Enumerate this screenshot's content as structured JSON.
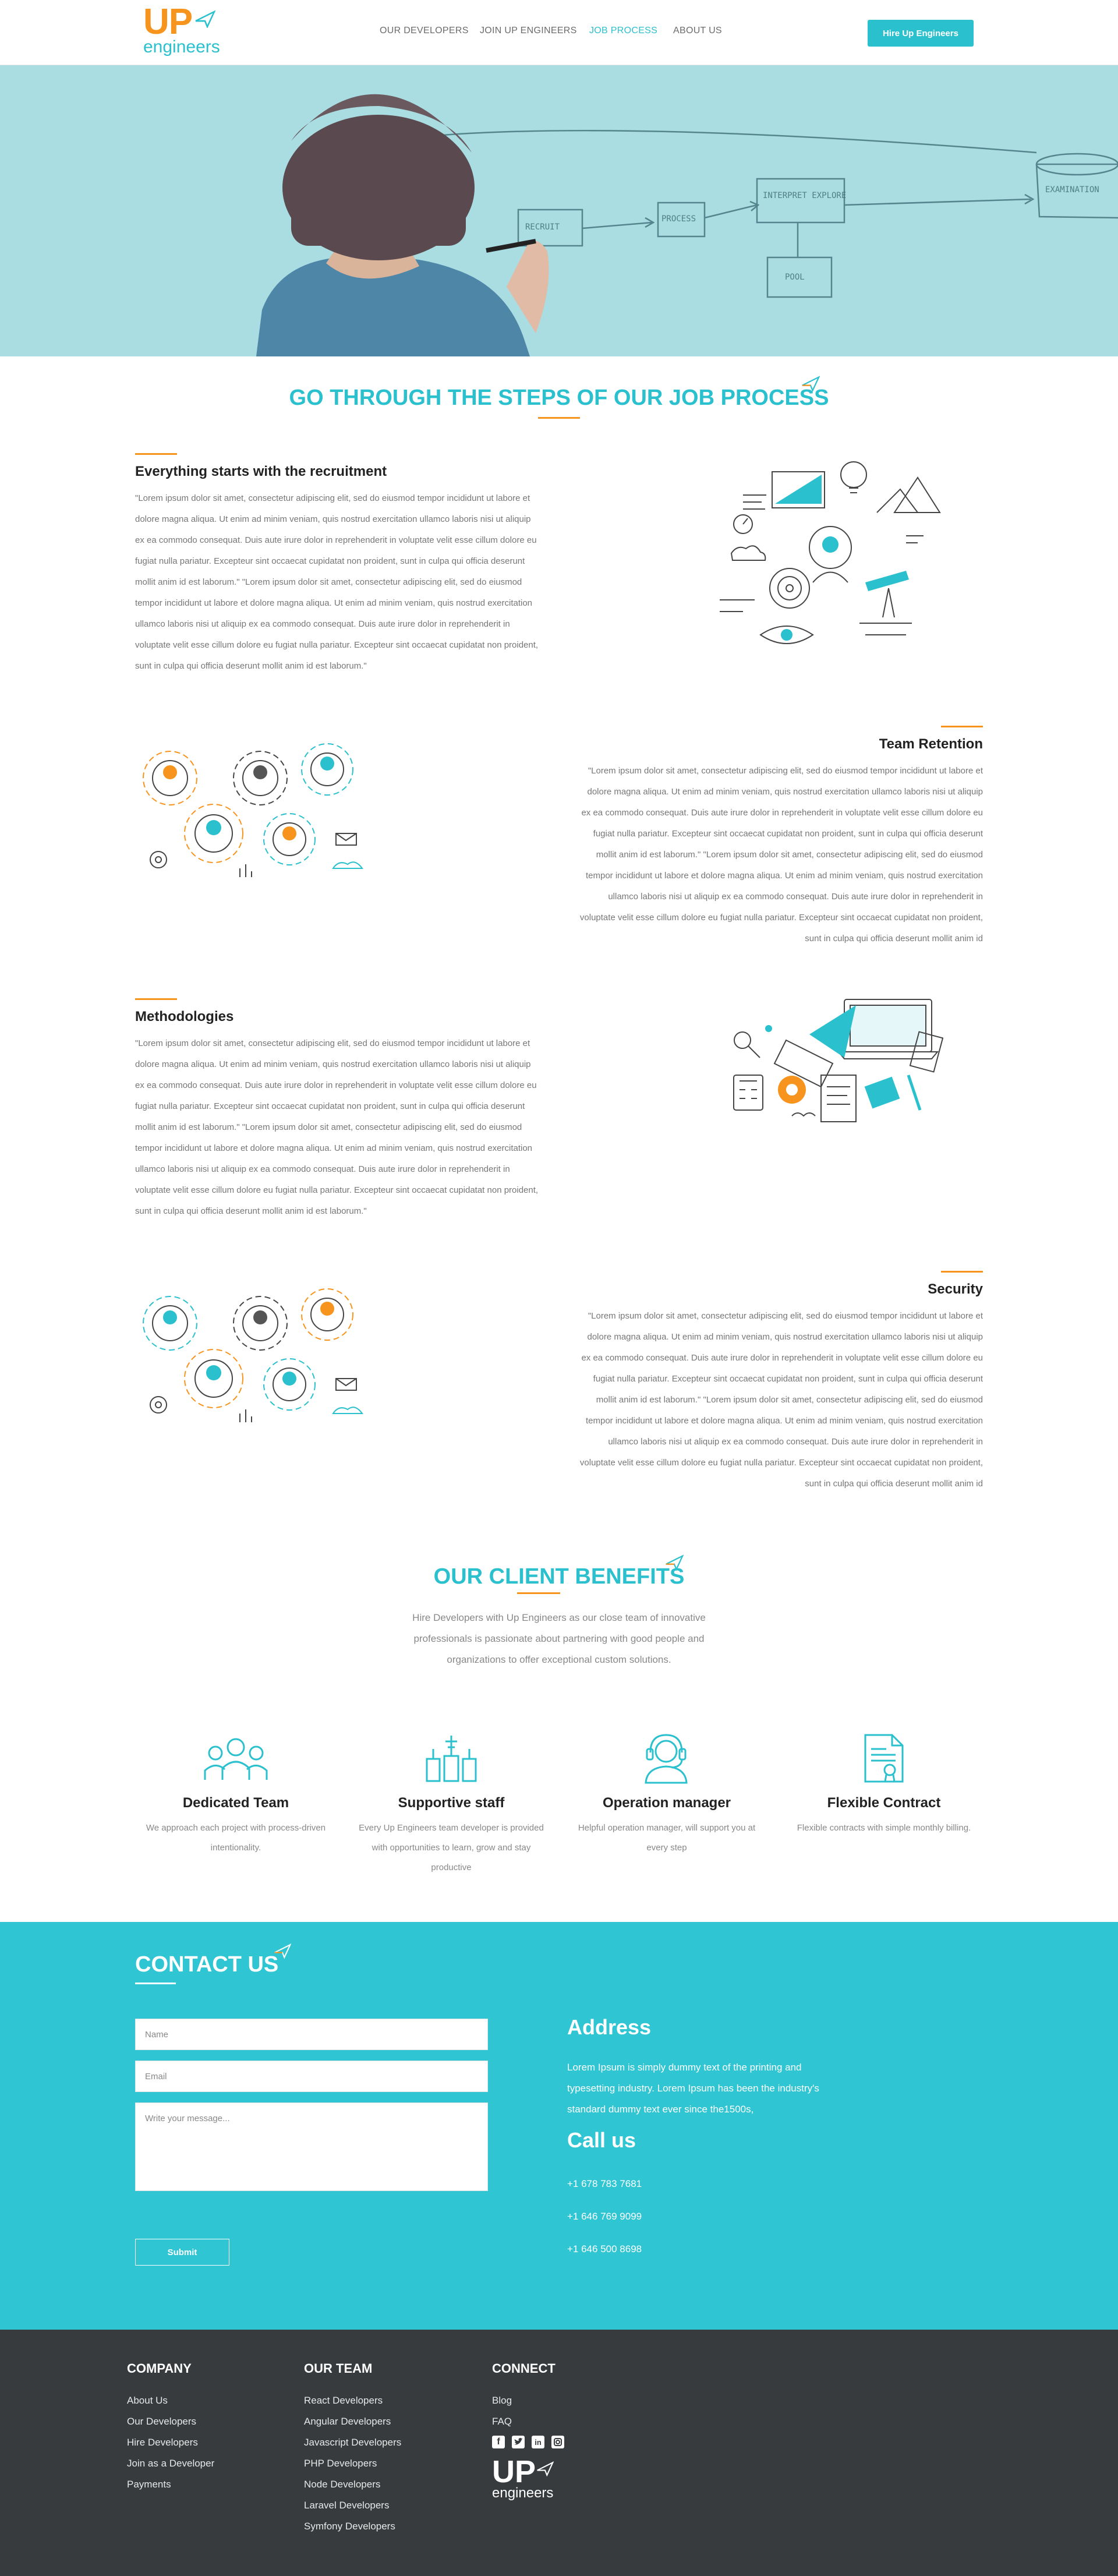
{
  "brand": {
    "logo_up": "UP",
    "logo_engineers": "engineers",
    "accent": "#2bc0ce",
    "orange": "#f7941d"
  },
  "nav": {
    "items": [
      "OUR DEVELOPERS",
      "JOIN UP ENGINEERS",
      "JOB PROCESS",
      "ABOUT US"
    ],
    "active": "JOB PROCESS",
    "cta": "Hire Up Engineers"
  },
  "hero": {
    "whiteboard": [
      "RECRUIT",
      "PROCESS",
      "INTERPRET EXPLORE",
      "POOL",
      "EXAMINATION"
    ]
  },
  "process": {
    "title": "GO THROUGH THE STEPS OF OUR JOB PROCESS",
    "steps": [
      {
        "title": "Everything starts with the recruitment",
        "text": "\"Lorem ipsum dolor sit amet, consectetur adipiscing elit, sed do eiusmod tempor incididunt ut labore et dolore magna aliqua. Ut enim ad minim veniam, quis nostrud exercitation ullamco laboris nisi ut aliquip ex ea commodo consequat. Duis aute irure dolor in reprehenderit in voluptate velit esse cillum dolore eu fugiat nulla pariatur. Excepteur sint occaecat cupidatat non proident, sunt in culpa qui officia deserunt mollit anim id est laborum.\" \"Lorem ipsum dolor sit amet, consectetur adipiscing elit, sed do eiusmod tempor incididunt ut labore et dolore magna aliqua. Ut enim ad minim veniam, quis nostrud exercitation ullamco laboris nisi ut aliquip ex ea commodo consequat. Duis aute irure dolor in reprehenderit in voluptate velit esse cillum dolore eu fugiat nulla pariatur. Excepteur sint occaecat cupidatat non proident, sunt in culpa qui officia deserunt mollit anim id est laborum.\""
      },
      {
        "title": "Team Retention",
        "text": "\"Lorem ipsum dolor sit amet, consectetur adipiscing elit, sed do eiusmod tempor incididunt ut labore et dolore magna aliqua. Ut enim ad minim veniam, quis nostrud exercitation ullamco laboris nisi ut aliquip ex ea commodo consequat. Duis aute irure dolor in reprehenderit in voluptate velit esse cillum dolore eu fugiat nulla pariatur. Excepteur sint occaecat cupidatat non proident, sunt in culpa qui officia deserunt mollit anim id est laborum.\" \"Lorem ipsum dolor sit amet, consectetur adipiscing elit, sed do eiusmod tempor incididunt ut labore et dolore magna aliqua. Ut enim ad minim veniam, quis nostrud exercitation ullamco laboris nisi ut aliquip ex ea commodo consequat. Duis aute irure dolor in reprehenderit in voluptate velit esse cillum dolore eu fugiat nulla pariatur. Excepteur sint occaecat cupidatat non proident, sunt in culpa qui officia deserunt mollit anim id"
      },
      {
        "title": "Methodologies",
        "text": "\"Lorem ipsum dolor sit amet, consectetur adipiscing elit, sed do eiusmod tempor incididunt ut labore et dolore magna aliqua. Ut enim ad minim veniam, quis nostrud exercitation ullamco laboris nisi ut aliquip ex ea commodo consequat. Duis aute irure dolor in reprehenderit in voluptate velit esse cillum dolore eu fugiat nulla pariatur. Excepteur sint occaecat cupidatat non proident, sunt in culpa qui officia deserunt mollit anim id est laborum.\" \"Lorem ipsum dolor sit amet, consectetur adipiscing elit, sed do eiusmod tempor incididunt ut labore et dolore magna aliqua. Ut enim ad minim veniam, quis nostrud exercitation ullamco laboris nisi ut aliquip ex ea commodo consequat. Duis aute irure dolor in reprehenderit in voluptate velit esse cillum dolore eu fugiat nulla pariatur. Excepteur sint occaecat cupidatat non proident, sunt in culpa qui officia deserunt mollit anim id est laborum.\""
      },
      {
        "title": "Security",
        "text": "\"Lorem ipsum dolor sit amet, consectetur adipiscing elit, sed do eiusmod tempor incididunt ut labore et dolore magna aliqua. Ut enim ad minim veniam, quis nostrud exercitation ullamco laboris nisi ut aliquip ex ea commodo consequat. Duis aute irure dolor in reprehenderit in voluptate velit esse cillum dolore eu fugiat nulla pariatur. Excepteur sint occaecat cupidatat non proident, sunt in culpa qui officia deserunt mollit anim id est laborum.\" \"Lorem ipsum dolor sit amet, consectetur adipiscing elit, sed do eiusmod tempor incididunt ut labore et dolore magna aliqua. Ut enim ad minim veniam, quis nostrud exercitation ullamco laboris nisi ut aliquip ex ea commodo consequat. Duis aute irure dolor in reprehenderit in voluptate velit esse cillum dolore eu fugiat nulla pariatur. Excepteur sint occaecat cupidatat non proident, sunt in culpa qui officia deserunt mollit anim id"
      }
    ]
  },
  "benefits": {
    "title": "OUR CLIENT BENEFITS",
    "intro": "Hire Developers with Up Engineers as our close team of innovative professionals is passionate about partnering with good people and organizations to offer exceptional custom solutions.",
    "items": [
      {
        "title": "Dedicated Team",
        "text": "We approach each project with process-driven intentionality.",
        "icon": "team-icon"
      },
      {
        "title": "Supportive staff",
        "text": "Every Up Engineers team developer is provided with opportunities to learn, grow and stay productive",
        "icon": "staff-icon"
      },
      {
        "title": "Operation manager",
        "text": "Helpful operation manager, will support you at every step",
        "icon": "headset-icon"
      },
      {
        "title": "Flexible Contract",
        "text": "Flexible contracts with simple monthly billing.",
        "icon": "contract-icon"
      }
    ]
  },
  "contact": {
    "title": "CONTACT US",
    "name_placeholder": "Name",
    "email_placeholder": "Email",
    "message_placeholder": "Write your message...",
    "submit": "Submit",
    "address_title": "Address",
    "address_text": "Lorem Ipsum is simply dummy text of the printing and typesetting industry. Lorem Ipsum has been the industry's standard dummy text ever since the1500s,",
    "call_title": "Call us",
    "phones": [
      "+1 678 783 7681",
      "+1 646 769 9099",
      "+1 646 500 8698"
    ]
  },
  "footer": {
    "company": {
      "title": "COMPANY",
      "links": [
        "About Us",
        "Our Developers",
        "Hire Developers",
        "Join as a Developer",
        "Payments"
      ]
    },
    "team": {
      "title": "OUR TEAM",
      "links": [
        "React Developers",
        "Angular Developers",
        "Javascript Developers",
        "PHP Developers",
        "Node Developers",
        "Laravel Developers",
        "Symfony Developers"
      ]
    },
    "connect": {
      "title": "CONNECT",
      "links": [
        "Blog",
        "FAQ"
      ],
      "social": [
        "facebook-icon",
        "twitter-icon",
        "linkedin-icon",
        "instagram-icon"
      ]
    }
  }
}
